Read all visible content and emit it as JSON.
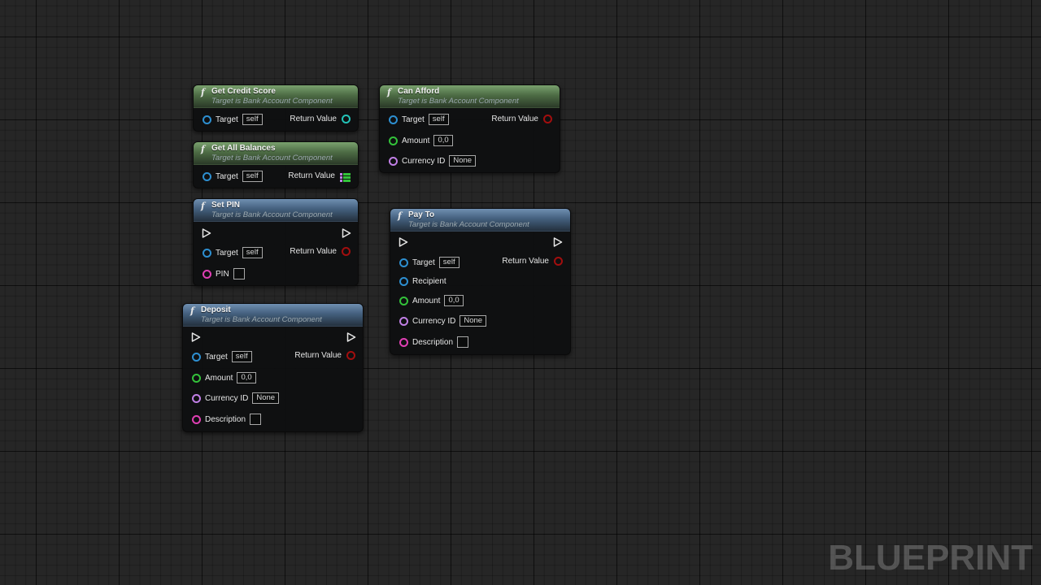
{
  "nodes": {
    "get_credit_score": {
      "title": "Get Credit Score",
      "subtitle": "Target is Bank Account Component",
      "target_label": "Target",
      "target_value": "self",
      "return_label": "Return Value"
    },
    "get_all_balances": {
      "title": "Get All Balances",
      "subtitle": "Target is Bank Account Component",
      "target_label": "Target",
      "target_value": "self",
      "return_label": "Return Value"
    },
    "set_pin": {
      "title": "Set PIN",
      "subtitle": "Target is Bank Account Component",
      "target_label": "Target",
      "target_value": "self",
      "return_label": "Return Value",
      "pin_label": "PIN",
      "pin_value": ""
    },
    "deposit": {
      "title": "Deposit",
      "subtitle": "Target is Bank Account Component",
      "target_label": "Target",
      "target_value": "self",
      "return_label": "Return Value",
      "amount_label": "Amount",
      "amount_value": "0,0",
      "currency_label": "Currency ID",
      "currency_value": "None",
      "description_label": "Description",
      "description_value": ""
    },
    "can_afford": {
      "title": "Can Afford",
      "subtitle": "Target is Bank Account Component",
      "target_label": "Target",
      "target_value": "self",
      "return_label": "Return Value",
      "amount_label": "Amount",
      "amount_value": "0,0",
      "currency_label": "Currency ID",
      "currency_value": "None"
    },
    "pay_to": {
      "title": "Pay To",
      "subtitle": "Target is Bank Account Component",
      "target_label": "Target",
      "target_value": "self",
      "return_label": "Return Value",
      "recipient_label": "Recipient",
      "amount_label": "Amount",
      "amount_value": "0,0",
      "currency_label": "Currency ID",
      "currency_value": "None",
      "description_label": "Description",
      "description_value": ""
    }
  },
  "watermark": "BLUEPRINT",
  "colors": {
    "pure_header": "#4d6c45",
    "impure_header": "#44607e",
    "object_pin": "#2d8fd1",
    "float_pin": "#33c23a",
    "name_pin": "#c17fe6",
    "string_pin": "#e03fb4",
    "bool_pin": "#a20e0e",
    "background": "#262626"
  }
}
